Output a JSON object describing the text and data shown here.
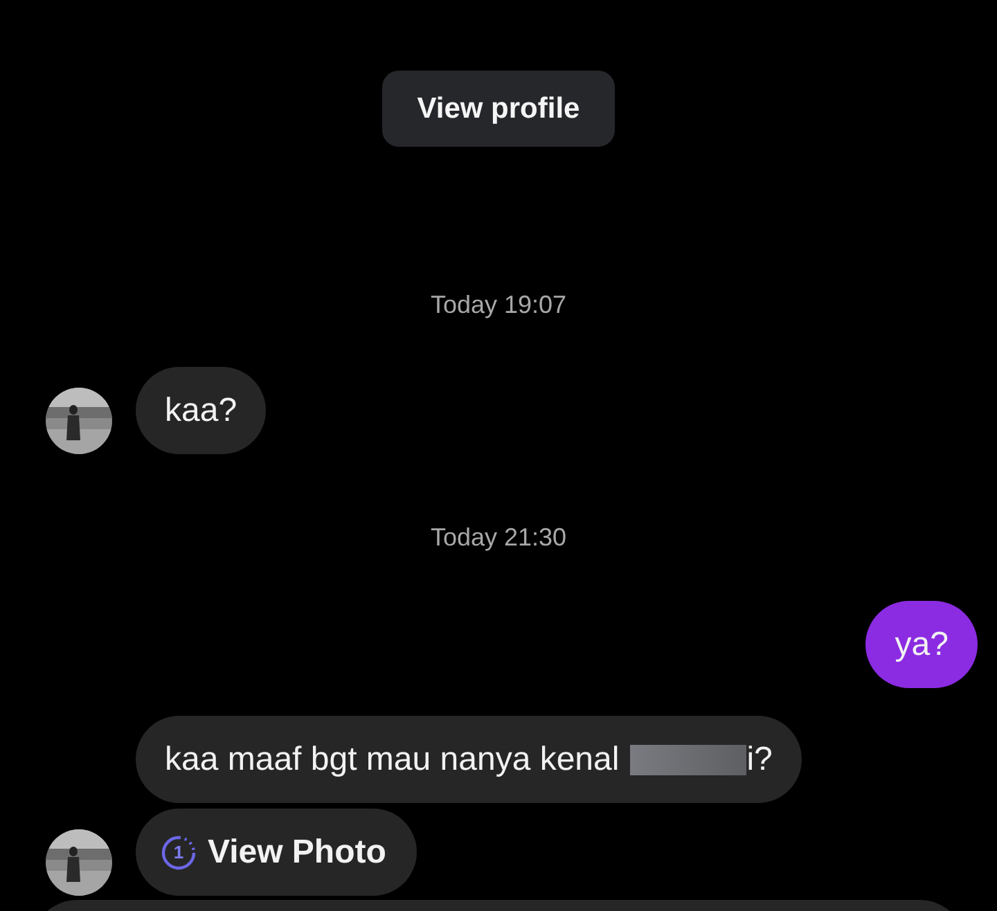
{
  "profile_button": {
    "label": "View profile"
  },
  "thread": [
    {
      "kind": "time",
      "text": "Today 19:07"
    },
    {
      "kind": "received",
      "text": "kaa?",
      "avatar": true
    },
    {
      "kind": "time",
      "text": "Today 21:30"
    },
    {
      "kind": "sent",
      "text": "ya?"
    },
    {
      "kind": "received",
      "text": "kaa maaf bgt mau nanya kenal",
      "redacted": true,
      "after": "i?",
      "avatar": false
    },
    {
      "kind": "photo",
      "label": "View Photo",
      "count": "1",
      "avatar": true
    }
  ]
}
